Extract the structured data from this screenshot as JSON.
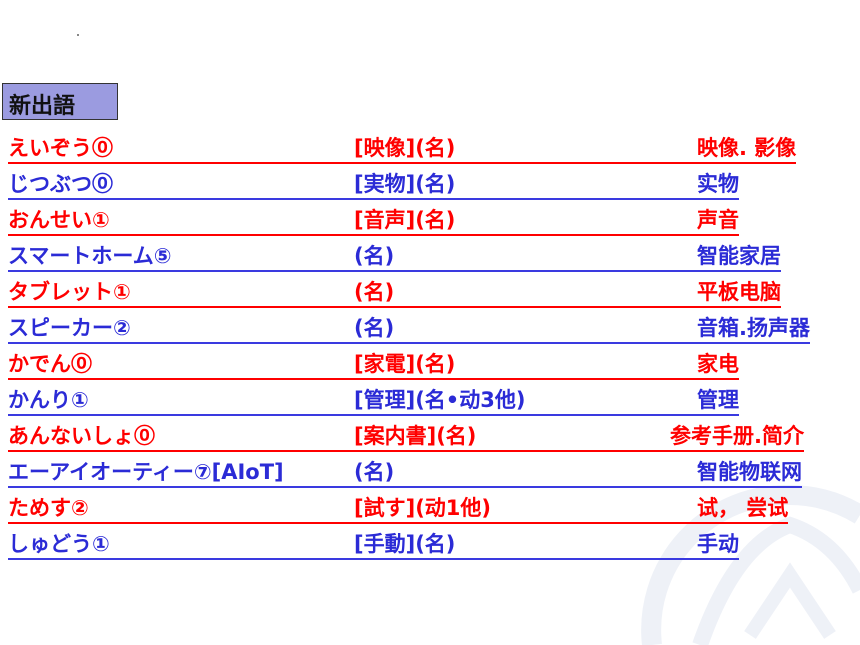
{
  "title": "新出語",
  "colors": {
    "red": "#ff0000",
    "blue": "#2b2bd6",
    "header_bg": "#9b9be0"
  },
  "rows": [
    {
      "word": "えいぞう⓪",
      "kanji": "[映像](名)",
      "meaning": "映像. 影像",
      "color": "red"
    },
    {
      "word": "じつぶつ⓪",
      "kanji": "[実物](名)",
      "meaning": "实物",
      "color": "blue"
    },
    {
      "word": "おんせい①",
      "kanji": "[音声](名)",
      "meaning": "声音",
      "color": "red"
    },
    {
      "word": "スマートホーム⑤",
      "kanji": "(名)",
      "meaning": "智能家居",
      "color": "blue"
    },
    {
      "word": "タブレット①",
      "kanji": "(名)",
      "meaning": "平板电脑",
      "color": "red"
    },
    {
      "word": "スピーカー②",
      "kanji": "(名)",
      "meaning": "音箱.扬声器",
      "color": "blue"
    },
    {
      "word": "かでん⓪",
      "kanji": "[家電](名)",
      "meaning": "家电",
      "color": "red"
    },
    {
      "word": "かんり①",
      "kanji": "[管理](名•动3他)",
      "meaning": "管理",
      "color": "blue"
    },
    {
      "word": "あんないしょ⓪",
      "kanji": "[案内書](名)",
      "meaning": "参考手册.简介",
      "color": "red"
    },
    {
      "word": "エーアイオーティー⑦[AIoT]",
      "kanji": "(名)",
      "meaning": "智能物联网",
      "color": "blue"
    },
    {
      "word": "ためす②",
      "kanji": "[試す](动1他)",
      "meaning": "试，  尝试",
      "color": "red"
    },
    {
      "word": "しゅどう①",
      "kanji": "[手動](名)",
      "meaning": "手动",
      "color": "blue"
    }
  ]
}
